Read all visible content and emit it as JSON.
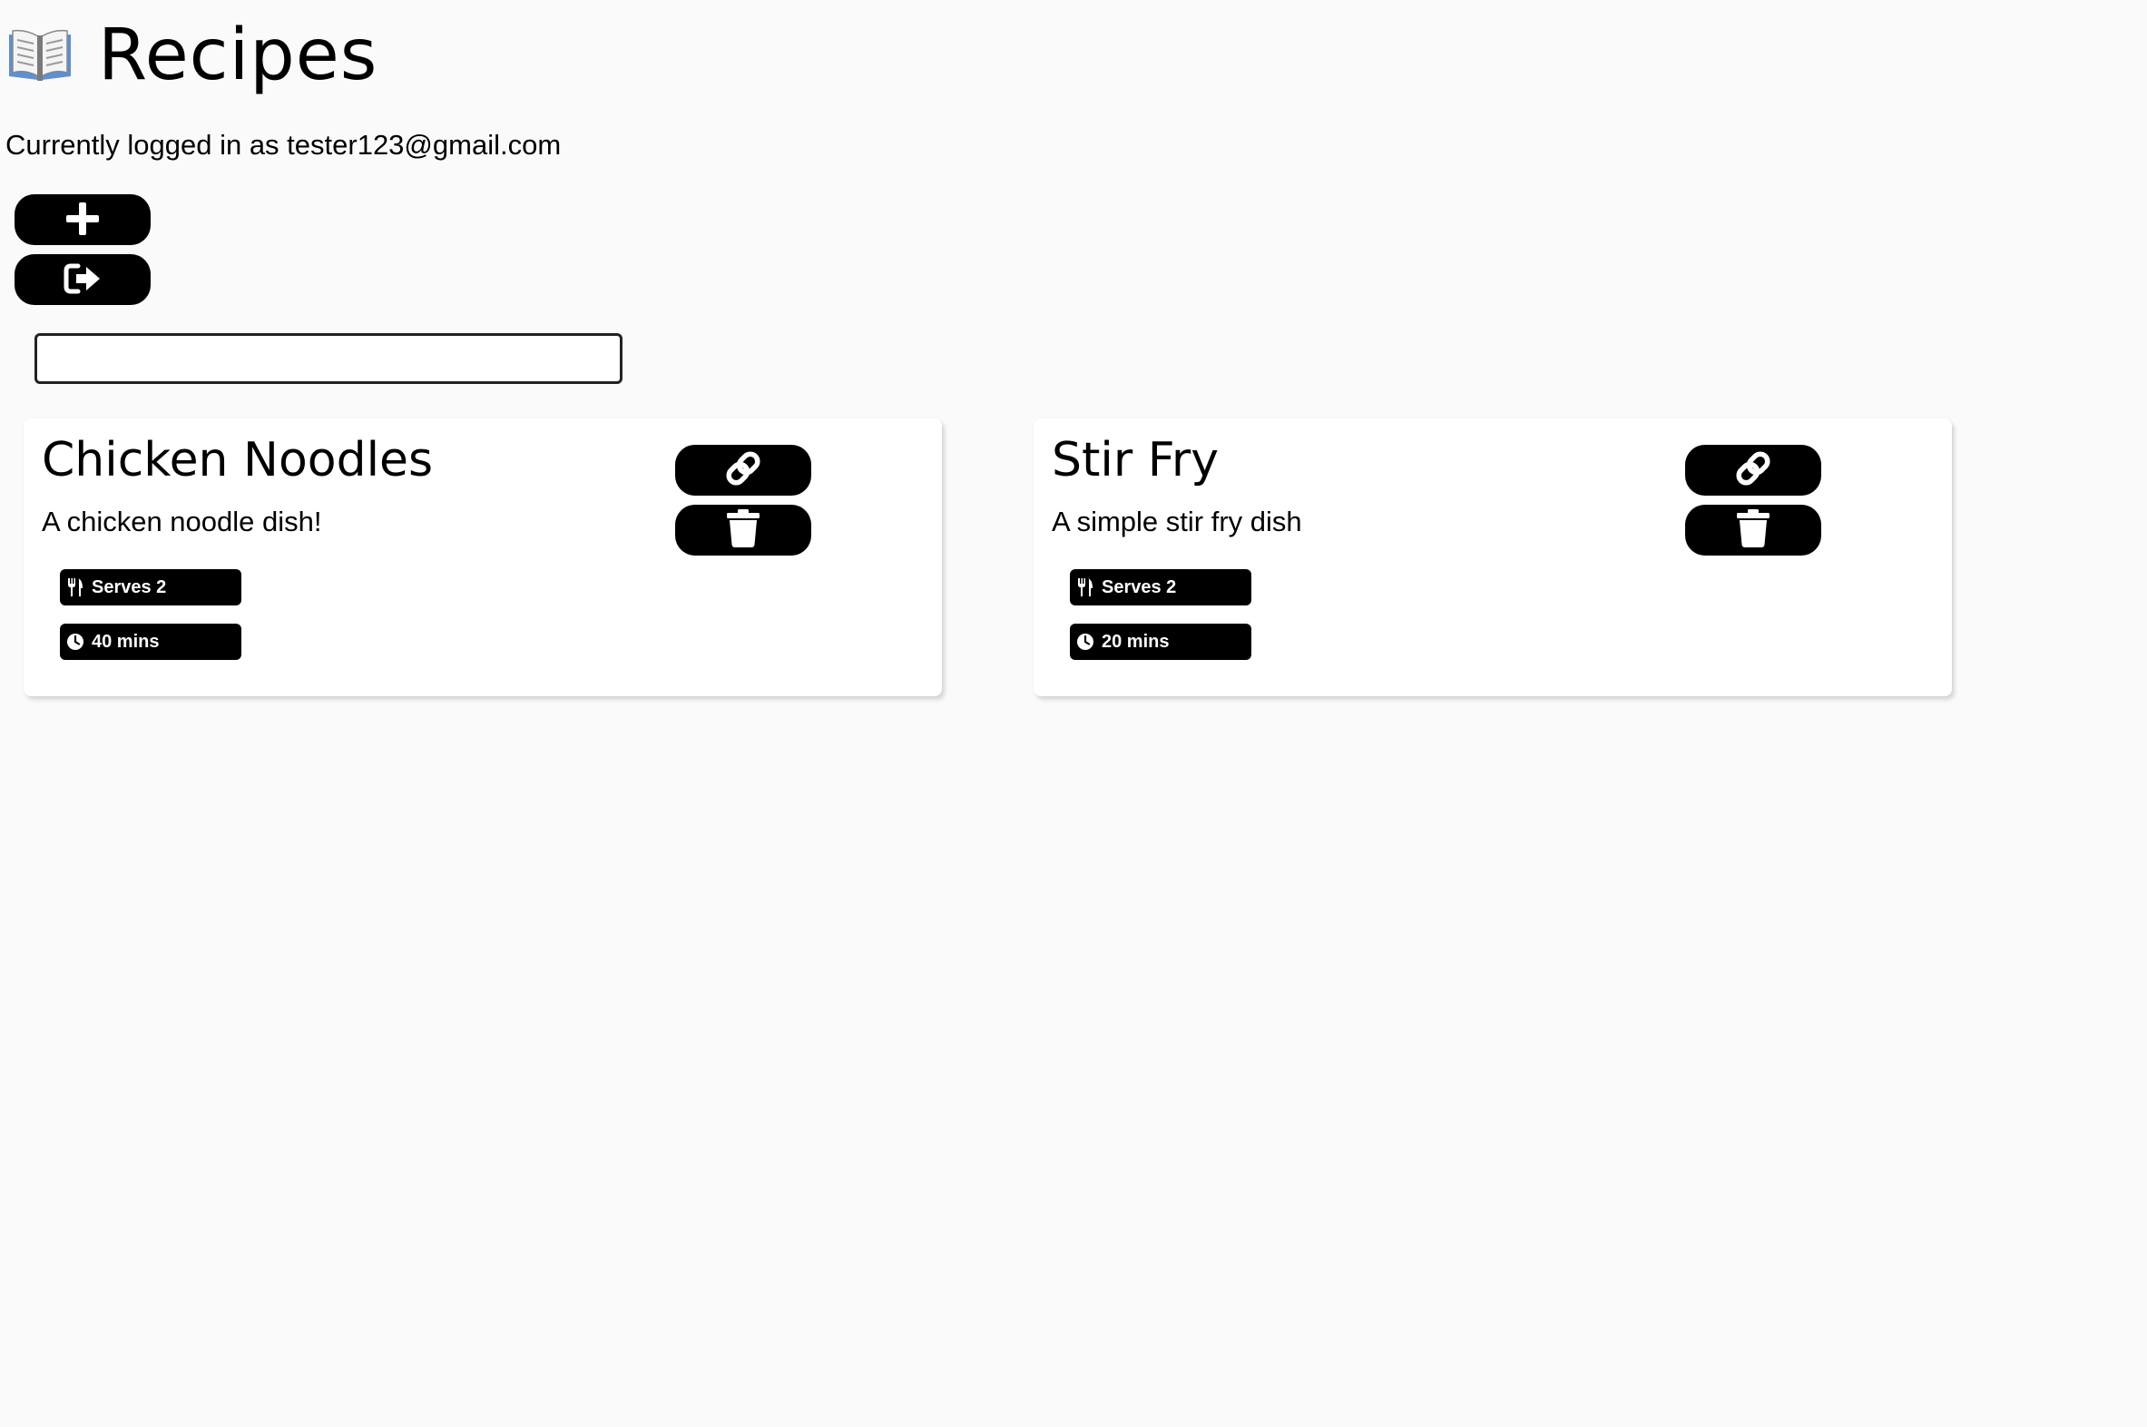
{
  "header": {
    "icon": "open-book-icon",
    "title": "Recipes"
  },
  "user": {
    "logged_in_text": "Currently logged in as tester123@gmail.com"
  },
  "actions": {
    "add_icon": "plus-icon",
    "logout_icon": "sign-out-icon"
  },
  "search": {
    "value": "",
    "placeholder": ""
  },
  "recipes": [
    {
      "title": "Chicken Noodles",
      "description": "A chicken noodle dish!",
      "serves": "Serves 2",
      "time": "40 mins",
      "link_icon": "link-icon",
      "delete_icon": "trash-icon"
    },
    {
      "title": "Stir Fry",
      "description": "A simple stir fry dish",
      "serves": "Serves 2",
      "time": "20 mins",
      "link_icon": "link-icon",
      "delete_icon": "trash-icon"
    }
  ],
  "colors": {
    "background": "#fafafa",
    "button": "#000000",
    "card": "#ffffff"
  }
}
